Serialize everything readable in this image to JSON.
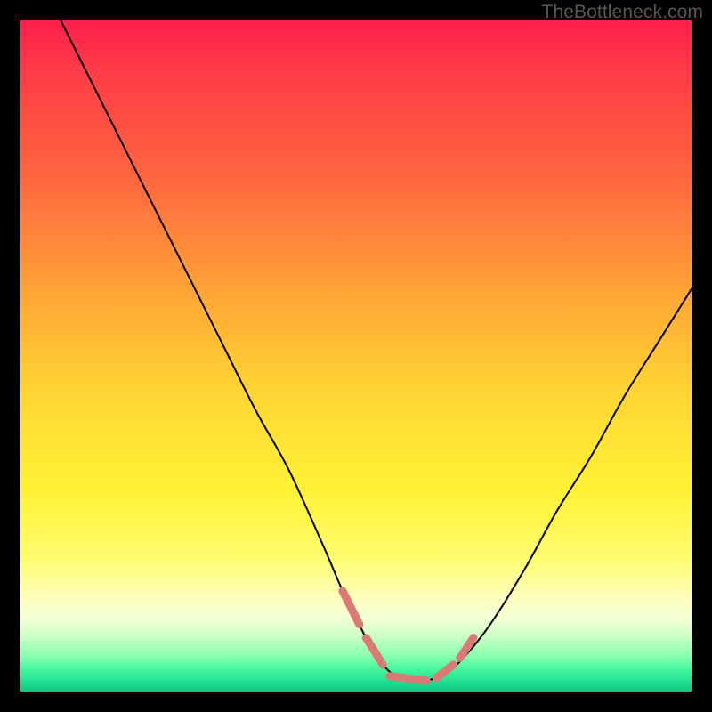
{
  "domain": "Chart",
  "watermark": "TheBottleneck.com",
  "chart_data": {
    "type": "line",
    "title": "",
    "xlabel": "",
    "ylabel": "",
    "xlim": [
      0,
      100
    ],
    "ylim": [
      0,
      100
    ],
    "series": [
      {
        "name": "curve-black",
        "color": "#000000",
        "width": 2,
        "x": [
          6,
          10,
          15,
          20,
          25,
          30,
          35,
          40,
          45,
          48,
          50,
          52,
          54,
          56,
          58,
          60,
          63,
          66,
          70,
          75,
          80,
          85,
          90,
          95,
          100
        ],
        "values": [
          100,
          92,
          82,
          72,
          62,
          52,
          42,
          33,
          22,
          15,
          11,
          7,
          4,
          2.2,
          1.5,
          1.5,
          2.5,
          5,
          10,
          18,
          27,
          35,
          44,
          52,
          60
        ]
      },
      {
        "name": "overlay-coral-segments",
        "color": "#d97a76",
        "width": 9,
        "segments": [
          {
            "x": [
              48.0,
              50.5
            ],
            "values": [
              15.0,
              10.0
            ]
          },
          {
            "x": [
              51.5,
              54.0
            ],
            "values": [
              8.0,
              4.0
            ]
          },
          {
            "x": [
              55.0,
              60.5
            ],
            "values": [
              2.3,
              1.6
            ]
          },
          {
            "x": [
              62.0,
              64.5
            ],
            "values": [
              2.0,
              4.0
            ]
          },
          {
            "x": [
              65.5,
              67.5
            ],
            "values": [
              5.0,
              8.0
            ]
          }
        ]
      }
    ]
  }
}
